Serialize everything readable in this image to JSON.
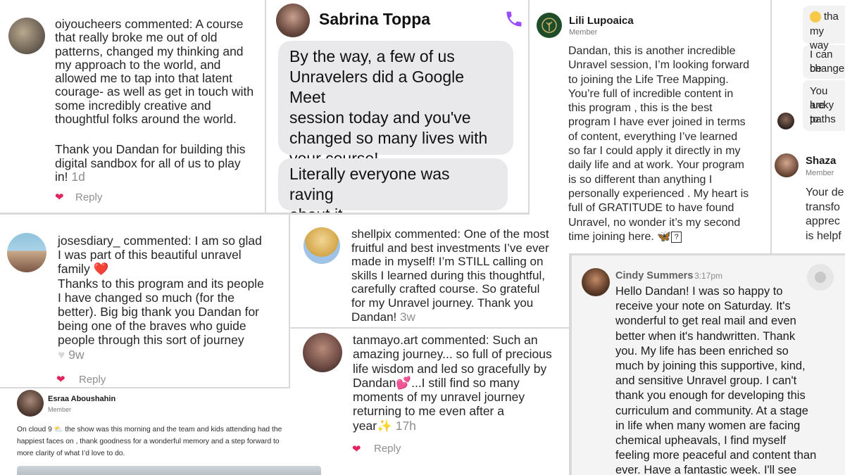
{
  "oiyou": {
    "username": "oiyoucheers",
    "comment_lines": [
      "commented: A course",
      "that really broke me out of old",
      "patterns, changed my thinking and",
      "my approach to the world, and",
      "allowed me to tap into that latent",
      "courage- as well as get in touch with",
      "some incredibly creative and",
      "thoughtful folks around the world."
    ],
    "comment2_lines": [
      "Thank you Dandan for building this",
      "digital sandbox for all of us to play"
    ],
    "comment2_last": "in!",
    "time": "1d",
    "reply": "Reply"
  },
  "sabrina": {
    "name": "Sabrina Toppa",
    "bubble1_lines": [
      "By the way, a few of us",
      "Unravelers did a Google Meet",
      "session today and you've",
      "changed so many lives with",
      "your course!"
    ],
    "bubble2_lines": [
      "Literally everyone was raving",
      "about it"
    ]
  },
  "lili": {
    "name": "Lili Lupoaica",
    "role": "Member",
    "lines": [
      "Dandan, this is another incredible",
      "Unravel session, I’m looking forward",
      "to joining the Life Tree Mapping.",
      "You’re full of incredible content in",
      "this program , this is the best",
      "program I have ever joined in terms",
      "of content, everything I’ve learned",
      "so far I could apply it directly in my",
      "daily life and at work. Your program",
      "is so different than anything I",
      "personally experienced . My heart is",
      "full of GRATITUDE to have found",
      "Unravel, no wonder it’s my second"
    ],
    "last_line": "time joining here. 🦋"
  },
  "right_top": {
    "lines": [
      "tha",
      "my way",
      "I can be",
      "change",
      "You are",
      "lucky to",
      "paths"
    ],
    "shaza_name": "Shaza",
    "shaza_role": "Member",
    "shaza_lines": [
      "Your de",
      "transfo",
      "apprec",
      "is helpf"
    ]
  },
  "joses": {
    "username": "josesdiary_",
    "lines": [
      "commented: I am so glad",
      "I was part of this beautiful unravel"
    ],
    "family": "family",
    "lines2": [
      "Thanks to this program and its people",
      "I have changed so much (for the",
      "better). Big big thank you Dandan for",
      "being one of the braves who guide",
      "people through this sort of journey"
    ],
    "time": "9w",
    "reply": "Reply"
  },
  "shellpix": {
    "username": "shellpix",
    "lines": [
      "commented: One of the most",
      "fruitful and best investments I’ve ever",
      "made in myself! I’m STILL calling on",
      "skills I learned during this thoughtful,",
      "carefully crafted course. So grateful",
      "for my Unravel journey. Thank you"
    ],
    "last": "Dandan!",
    "time": "3w"
  },
  "tanmayo": {
    "username": "tanmayo.art",
    "lines": [
      "commented: Such an",
      "amazing journey... so full of precious",
      "life wisdom and led so gracefully by"
    ],
    "dandan": "Dandan💕...I still find so many",
    "lines2": [
      "moments of my unravel journey",
      "returning to me even after a"
    ],
    "year": "year✨",
    "time": "17h",
    "reply": "Reply"
  },
  "esraa": {
    "name": "Esraa Aboushahin",
    "role": "Member",
    "lines": [
      "On cloud 9 ⛅ the show was this morning and the team and kids attending had the",
      "happiest faces on , thank goodness for a wonderful memory and a step forward to",
      "more clarity of what I’d love to do."
    ]
  },
  "cindy": {
    "name": "Cindy Summers",
    "time": "3:17pm",
    "lines": [
      "Hello Dandan!  I was so happy to",
      "receive your note on Saturday.  It's",
      "wonderful to get real mail and even",
      "better when it's handwritten.  Thank",
      "you.  My life has been enriched so",
      "much by joining this supportive, kind,",
      "and sensitive Unravel group.  I can't",
      "thank you enough for developing this",
      "curriculum and community.  At a stage",
      "in life when many women are facing",
      "chemical upheavals, I find myself",
      "feeling more peaceful and content than",
      "ever.  Have a fantastic week.  I'll see"
    ]
  },
  "colors": {
    "heart": "#e0245e",
    "phone": "#9b4dff",
    "bubble": "#e9e9eb"
  }
}
